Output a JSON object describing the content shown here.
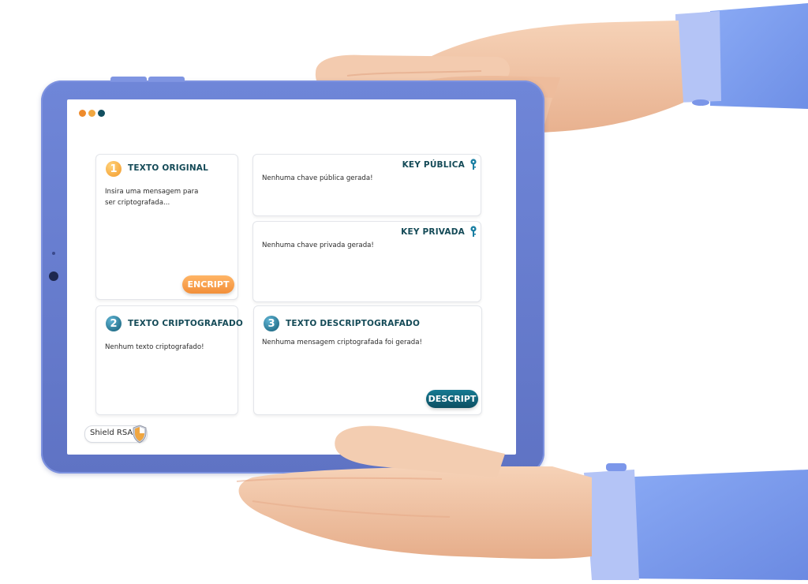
{
  "colors": {
    "tablet_frame": "#6a7fd2",
    "skin": "#f1c5a6",
    "sleeve": "#7e9ef0",
    "cuff": "#b2c2f5",
    "title_text": "#144a57",
    "encript_button": "#f7a24d",
    "descript_button": "#0f5f73",
    "window_dot_1": "#ee8b2c",
    "window_dot_2": "#f0a640",
    "window_dot_3": "#124f60"
  },
  "cards": {
    "original": {
      "badge": "1",
      "title": "TEXTO ORIGINAL",
      "placeholder": "Insira uma mensagem para ser criptografada...",
      "button": "ENCRIPT"
    },
    "public_key": {
      "title": "KEY PÚBLICA",
      "icon": "key-icon",
      "text": "Nenhuma chave pública gerada!"
    },
    "private_key": {
      "title": "KEY PRIVADA",
      "icon": "key-icon",
      "text": "Nenhuma chave privada gerada!"
    },
    "encrypted": {
      "badge": "2",
      "title": "TEXTO CRIPTOGRAFADO",
      "text": "Nenhum texto criptografado!"
    },
    "decrypted": {
      "badge": "3",
      "title": "TEXTO DESCRIPTOGRAFADO",
      "text": "Nenhuma mensagem criptografada foi gerada!",
      "button": "DESCRIPT"
    }
  },
  "logo": {
    "text": "Shield RSA",
    "icon": "shield-icon"
  }
}
